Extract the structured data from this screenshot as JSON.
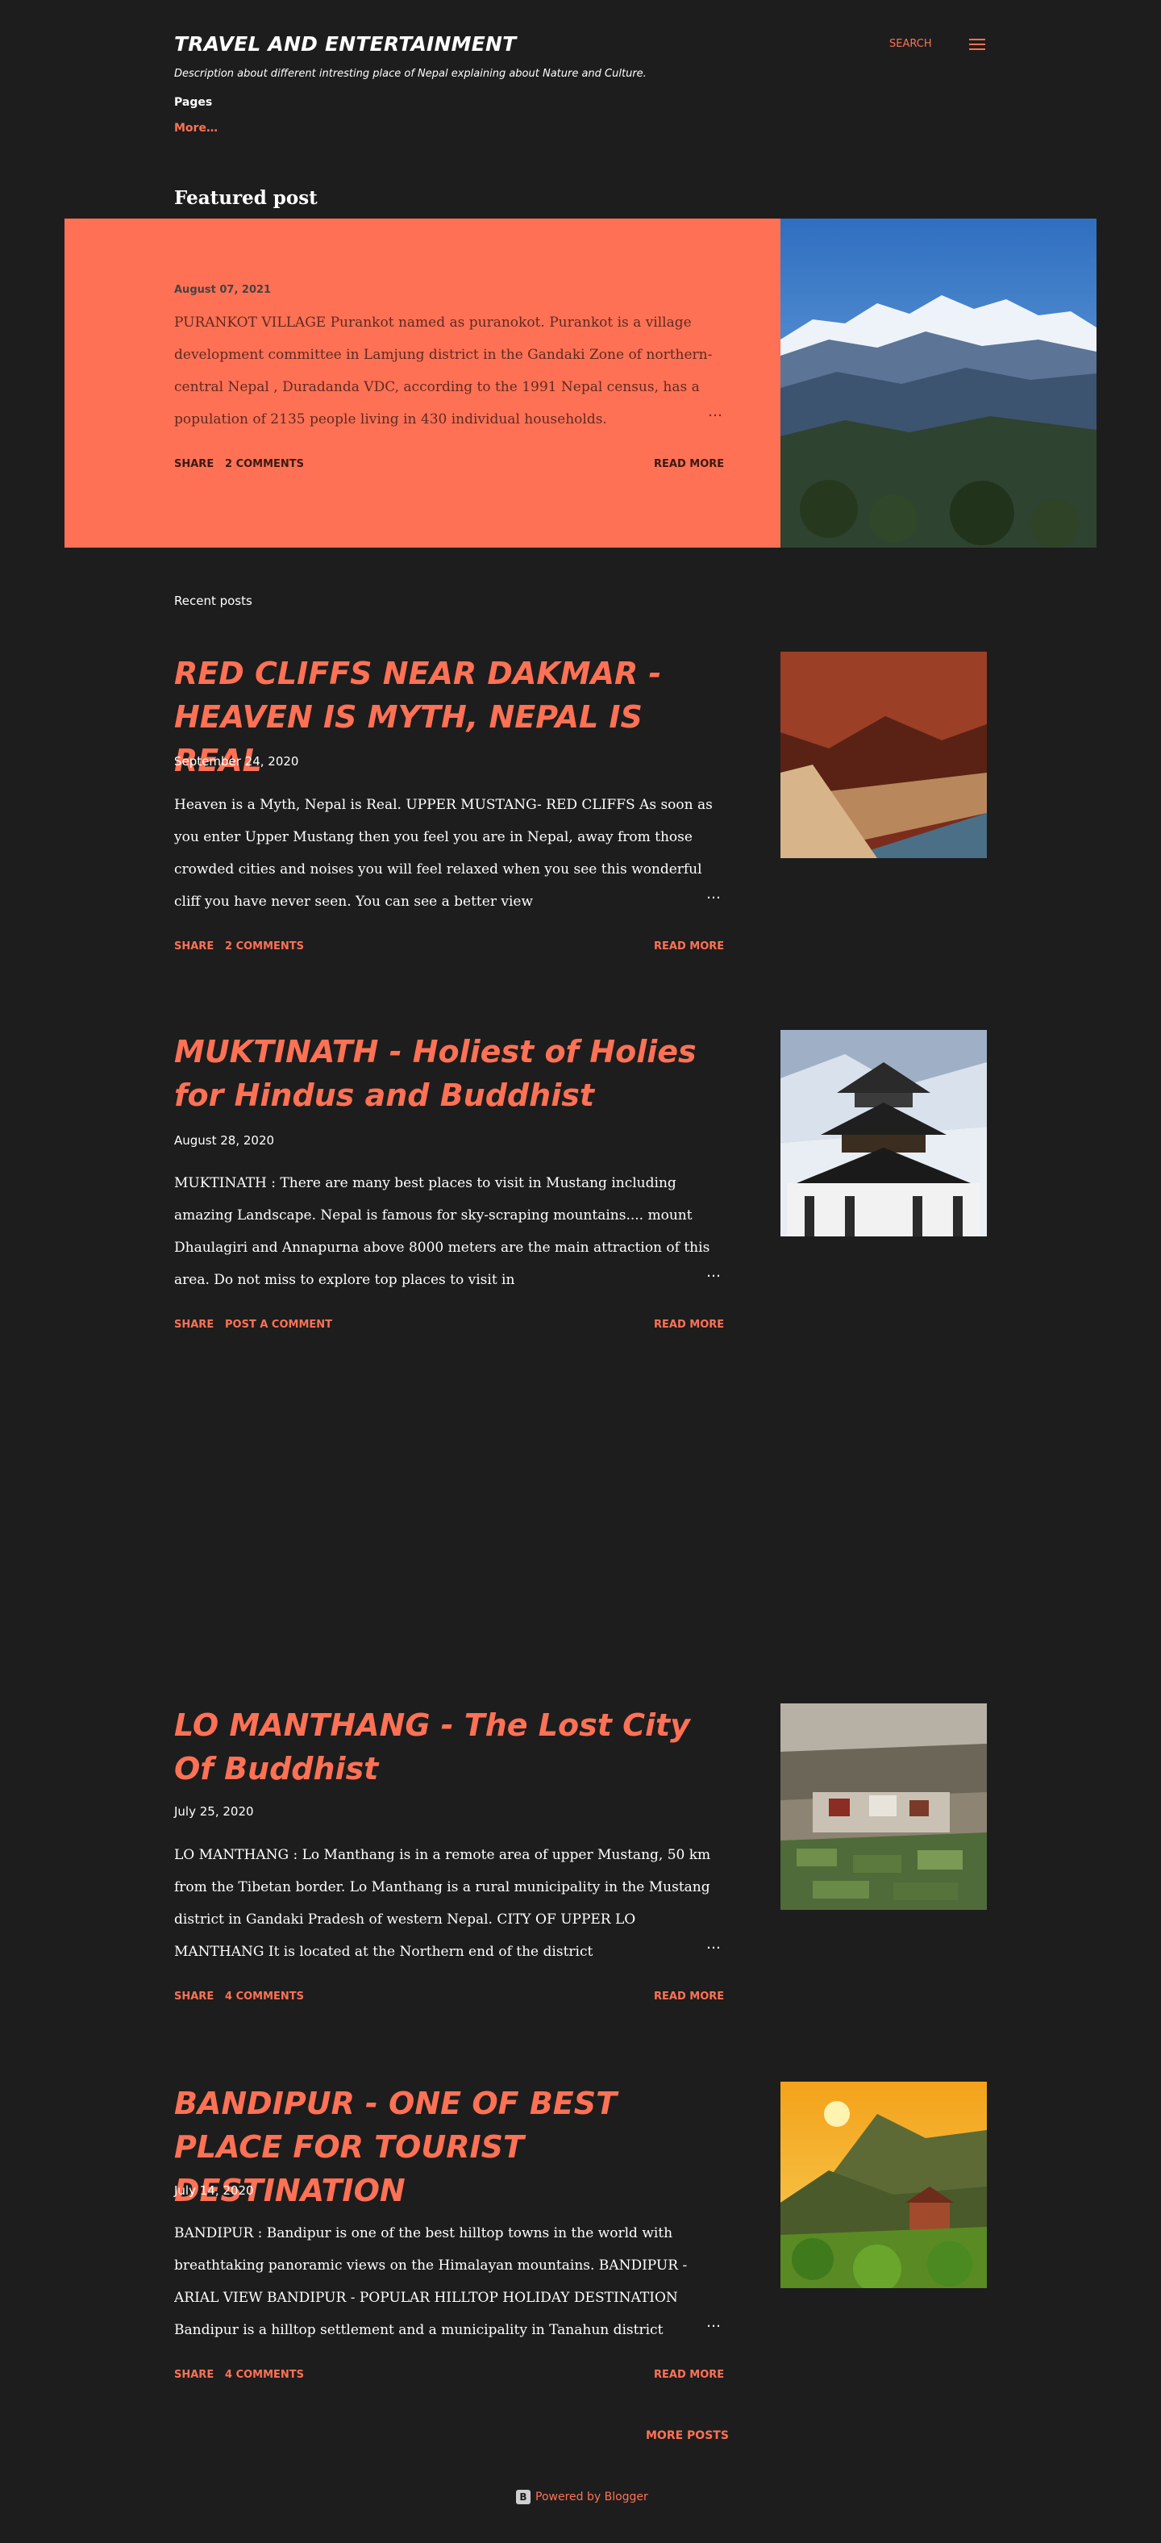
{
  "header": {
    "title": "TRAVEL AND ENTERTAINMENT",
    "description": "Description about different intresting place of Nepal explaining about Nature and Culture.",
    "pages_label": "Pages",
    "more_label": "More…",
    "search_label": "SEARCH",
    "menu_icon": "hamburger-menu-icon"
  },
  "featured": {
    "heading": "Featured post",
    "date": "August 07, 2021",
    "snippet": "  PURANKOT VILLAGE Purankot named as puranokot. Purankot is a village development committee in Lamjung district in the Gandaki Zone of northern-central Nepal ,  Duradanda VDC, according to the 1991 Nepal census, has a population of 2135 people living in 430 individual households.",
    "ellipsis": "…",
    "share_label": "SHARE",
    "comments_label": "2 COMMENTS",
    "read_more_label": "READ MORE"
  },
  "recent": {
    "heading": "Recent posts",
    "posts": [
      {
        "title": "RED CLIFFS NEAR DAKMAR - HEAVEN IS MYTH, NEPAL IS REAL",
        "date": "September 24, 2020",
        "snippet": "Heaven is a Myth, Nepal is Real. UPPER MUSTANG- RED CLIFFS   As soon as you enter Upper Mustang then you feel you are in Nepal, away from those crowded cities and noises you will feel relaxed when you see this wonderful cliff you have never seen. You can see a better view",
        "ellipsis": "…",
        "share_label": "SHARE",
        "comments_label": "2 COMMENTS",
        "read_more_label": "READ MORE"
      },
      {
        "title": "MUKTINATH - Holiest of Holies for Hindus and Buddhist",
        "date": "August 28, 2020",
        "snippet": "MUKTINATH : There are many best places to visit in Mustang including amazing Landscape. Nepal is famous for sky-scraping mountains.... mount Dhaulagiri and Annapurna above 8000 meters are the main attraction of this area.  Do not miss to explore top places to visit in",
        "ellipsis": "…",
        "share_label": "SHARE",
        "comments_label": "POST A COMMENT",
        "read_more_label": "READ MORE"
      },
      {
        "title": "LO MANTHANG - The Lost City Of Buddhist",
        "date": "July 25, 2020",
        "snippet": "LO  MANTHANG : Lo Manthang is in a remote area of upper Mustang, 50 km from the Tibetan border. Lo Manthang is a rural municipality in the Mustang district in Gandaki Pradesh of western Nepal. CITY OF UPPER LO MANTHANG  It is located at the Northern end of the district",
        "ellipsis": "…",
        "share_label": "SHARE",
        "comments_label": "4 COMMENTS",
        "read_more_label": "READ MORE"
      },
      {
        "title": "BANDIPUR - ONE OF BEST PLACE FOR TOURIST DESTINATION",
        "date": "July 14, 2020",
        "snippet": "BANDIPUR : Bandipur is one of the best hilltop towns in the world with breathtaking panoramic views on the Himalayan mountains. BANDIPUR - ARIAL VIEW BANDIPUR - POPULAR HILLTOP HOLIDAY DESTINATION Bandipur is a hilltop settlement and a municipality in Tanahun district",
        "ellipsis": "…",
        "share_label": "SHARE",
        "comments_label": "4 COMMENTS",
        "read_more_label": "READ MORE"
      }
    ]
  },
  "more_posts_label": "MORE POSTS",
  "footer": {
    "blogger_icon_letter": "B",
    "powered_by": "Powered by Blogger"
  },
  "colors": {
    "background": "#1d1d1d",
    "accent": "#ff7155",
    "text": "#ffffff"
  }
}
